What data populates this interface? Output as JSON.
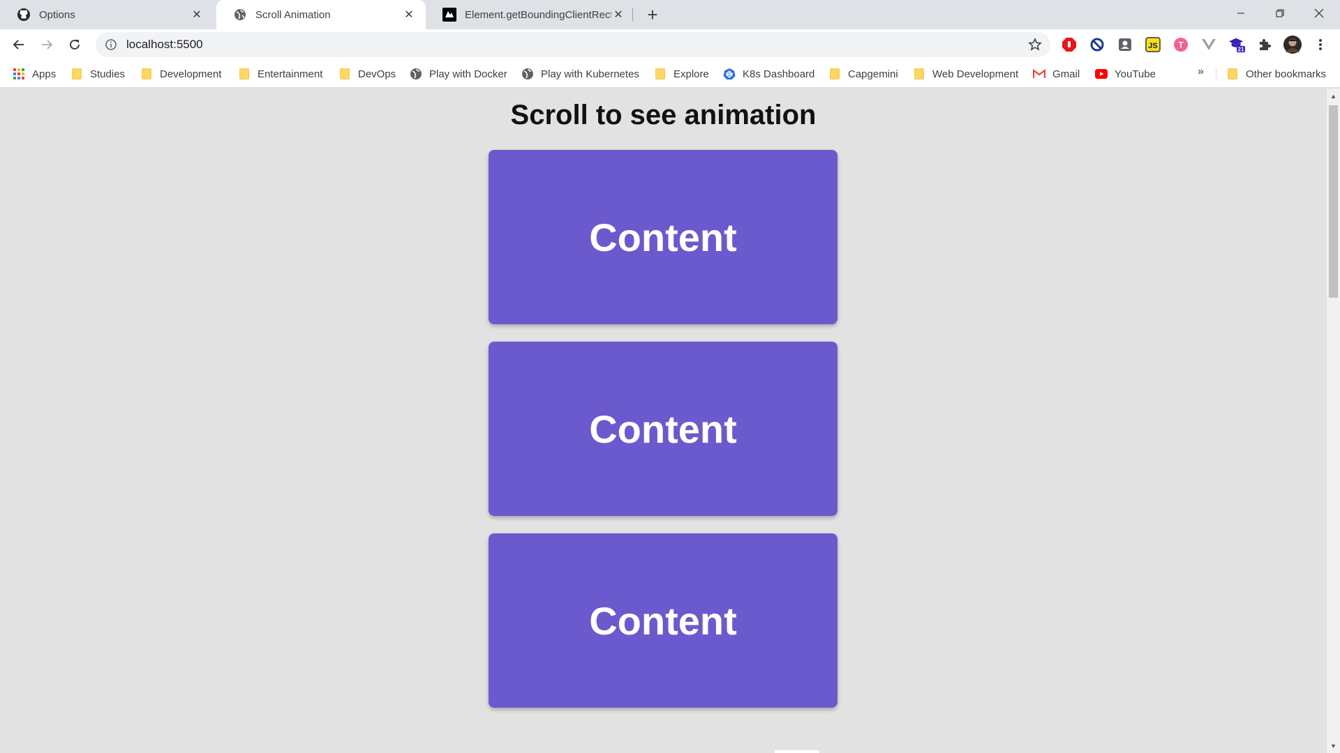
{
  "tabs": [
    {
      "title": "Options",
      "favicon": "github-icon",
      "active": false
    },
    {
      "title": "Scroll Animation",
      "favicon": "globe-icon",
      "active": true
    },
    {
      "title": "Element.getBoundingClientRect()",
      "favicon": "mdn-icon",
      "active": false
    }
  ],
  "toolbar": {
    "url": "localhost:5500"
  },
  "bookmarks": {
    "items": [
      {
        "label": "Apps",
        "icon": "apps-grid-icon"
      },
      {
        "label": "Studies",
        "icon": "folder-icon"
      },
      {
        "label": "Development",
        "icon": "folder-icon"
      },
      {
        "label": "Entertainment",
        "icon": "folder-icon"
      },
      {
        "label": "DevOps",
        "icon": "folder-icon"
      },
      {
        "label": "Play with Docker",
        "icon": "globe-icon"
      },
      {
        "label": "Play with Kubernetes",
        "icon": "globe-icon"
      },
      {
        "label": "Explore",
        "icon": "folder-icon"
      },
      {
        "label": "K8s Dashboard",
        "icon": "kubernetes-icon"
      },
      {
        "label": "Capgemini",
        "icon": "folder-icon"
      },
      {
        "label": "Web Development",
        "icon": "folder-icon"
      },
      {
        "label": "Gmail",
        "icon": "gmail-icon"
      },
      {
        "label": "YouTube",
        "icon": "youtube-icon"
      }
    ],
    "overflow": "»",
    "other": "Other bookmarks"
  },
  "extensions": {
    "badge": "21"
  },
  "page": {
    "heading": "Scroll to see animation",
    "cards": [
      "Content",
      "Content",
      "Content"
    ],
    "card_color": "#6b5acd",
    "background_color": "#e2e2e2"
  }
}
